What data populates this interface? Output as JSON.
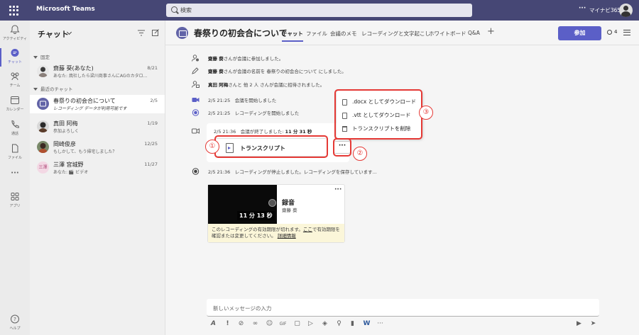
{
  "app": {
    "title": "Microsoft Teams",
    "tenant": "マイナビ365",
    "more": "···"
  },
  "search": {
    "placeholder": "検索"
  },
  "rail": [
    {
      "label": "アクティビティ",
      "icon": "bell-icon"
    },
    {
      "label": "チャット",
      "icon": "chat-icon"
    },
    {
      "label": "チーム",
      "icon": "teams-icon"
    },
    {
      "label": "カレンダー",
      "icon": "calendar-icon"
    },
    {
      "label": "通話",
      "icon": "phone-icon"
    },
    {
      "label": "ファイル",
      "icon": "file-icon"
    },
    {
      "label": "",
      "icon": "more-icon"
    },
    {
      "label": "アプリ",
      "icon": "apps-icon"
    },
    {
      "label": "ヘルプ",
      "icon": "help-icon"
    }
  ],
  "sidebar": {
    "title": "チャット",
    "pinned_label": "固定",
    "recent_label": "最近のチャット",
    "pinned": [
      {
        "name": "齋藤 葵(あなた)",
        "preview": "あなた: 焼社したら梁川商事さんにAGのカタロ…",
        "date": "8/21"
      }
    ],
    "recent": [
      {
        "name": "春祭りの初会合について",
        "preview": "レコーディング データが利用可能です",
        "date": "2/5"
      },
      {
        "name": "真田 阿梅",
        "preview": "参加よろしく",
        "date": "1/19"
      },
      {
        "name": "岡崎俊彦",
        "preview": "もしかして、もう帰宅しました？",
        "date": "12/25"
      },
      {
        "name": "三澤 宮城野",
        "preview": "あなた: 🎬 ビデオ",
        "date": "11/27"
      }
    ]
  },
  "chat": {
    "title": "春祭りの初会合について",
    "tabs": [
      "チャット",
      "ファイル",
      "会議のメモ",
      "レコーディングと文字起こし",
      "ホワイトボード",
      "Q&A"
    ],
    "add_tab": "+",
    "join_label": "参加",
    "participants": "4"
  },
  "events": [
    {
      "who": "齋藤 葵",
      "text": "さんが会議に参加しました。"
    },
    {
      "who": "齋藤 葵",
      "text": "さんが会議の名前を 春祭りの初会合について にしました。"
    },
    {
      "who": "真田 阿梅",
      "text": "さんと 他 2 人 さんが会議に招待されました。"
    }
  ],
  "meeting_events": [
    {
      "time": "2/5 21:25",
      "text": "会議を開始しました"
    },
    {
      "time": "2/5 21:25",
      "text": "レコーディングを開始しました"
    }
  ],
  "ended": {
    "time": "2/5 21:36",
    "text": "会議が終了しました:",
    "duration": "11 分 31 秒"
  },
  "transcript": {
    "label": "トランスクリプト",
    "more": "···"
  },
  "menu": [
    {
      "label": ".docx としてダウンロード",
      "icon": "document-icon"
    },
    {
      "label": ".vtt としてダウンロード",
      "icon": "document-icon"
    },
    {
      "label": "トランスクリプトを削除",
      "icon": "trash-icon"
    }
  ],
  "annotations": {
    "n1": "①",
    "n2": "②",
    "n3": "③"
  },
  "rec_stop": {
    "time": "2/5 21:36",
    "text": "レコーディングが停止しました。レコーディングを保存しています..."
  },
  "recording": {
    "title": "録音",
    "owner": "齋藤 葵",
    "duration": "11 分 13 秒",
    "more": "···",
    "warning_text": "このレコーディングの有効期限が切れます。",
    "warning_link1": "ここ",
    "warning_mid": "で有効期限を確認または変更してください。",
    "warning_link2": "詳細情報"
  },
  "composer": {
    "placeholder": "新しいメッセージの入力"
  },
  "colors": {
    "accent": "#5b5fc7",
    "topbar": "#464775",
    "annotation": "#e53935"
  }
}
